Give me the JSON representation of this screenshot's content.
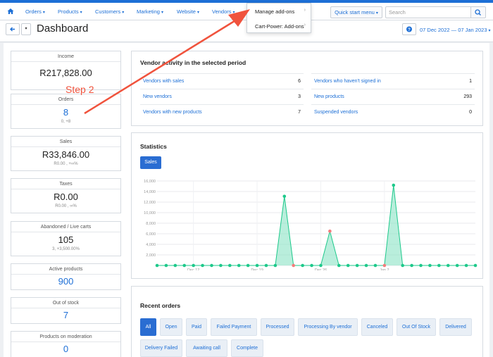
{
  "nav": {
    "items": [
      {
        "label": "Orders"
      },
      {
        "label": "Products"
      },
      {
        "label": "Customers"
      },
      {
        "label": "Marketing"
      },
      {
        "label": "Website"
      },
      {
        "label": "Vendors"
      }
    ],
    "quick_start": "Quick start menu",
    "search_placeholder": "Search"
  },
  "dropdown": {
    "items": [
      {
        "label": "Manage add-ons"
      },
      {
        "label": "Cart-Power: Add-ons"
      }
    ]
  },
  "header": {
    "title": "Dashboard",
    "date_range": "07 Dec 2022 — 07 Jan 2023"
  },
  "annotation": {
    "step": "Step 2",
    "color": "#f0533d"
  },
  "stats": [
    {
      "label": "Income",
      "value": "R217,828.00",
      "sub": ""
    },
    {
      "label": "Orders",
      "value": "8",
      "sub": "0, +8"
    },
    {
      "label": "Sales",
      "value": "R33,846.00",
      "sub": "R0.00 , +∞%"
    },
    {
      "label": "Taxes",
      "value": "R0.00",
      "sub": "R0.00 , ∞%"
    },
    {
      "label": "Abandoned / Live carts",
      "value": "105",
      "sub": "3, +3,500.00%"
    },
    {
      "label": "Active products",
      "value": "900",
      "sub": ""
    },
    {
      "label": "Out of stock",
      "value": "7",
      "sub": ""
    },
    {
      "label": "Products on moderation",
      "value": "0",
      "sub": ""
    }
  ],
  "vendor_activity": {
    "title": "Vendor activity in the selected period",
    "left": [
      {
        "label": "Vendors with sales",
        "value": "6"
      },
      {
        "label": "New vendors",
        "value": "3"
      },
      {
        "label": "Vendors with new products",
        "value": "7"
      }
    ],
    "right": [
      {
        "label": "Vendors who haven't signed in",
        "value": "1"
      },
      {
        "label": "New products",
        "value": "293"
      },
      {
        "label": "Suspended vendors",
        "value": "0"
      }
    ]
  },
  "statistics": {
    "title": "Statistics",
    "tab": "Sales"
  },
  "chart_data": {
    "type": "area",
    "title": "",
    "x_ticks": [
      "Dec 12",
      "Dec 19",
      "Dec 26",
      "Jan 2"
    ],
    "x_tick_index": [
      4,
      11,
      18,
      25
    ],
    "y_ticks": [
      "0",
      "2,000",
      "4,000",
      "6,000",
      "8,000",
      "10,000",
      "12,000",
      "14,000",
      "16,000"
    ],
    "ylim": [
      0,
      16000
    ],
    "series": [
      {
        "values": [
          0,
          0,
          0,
          0,
          0,
          0,
          0,
          0,
          0,
          0,
          0,
          0,
          0,
          0,
          13100,
          0,
          0,
          0,
          0,
          6500,
          0,
          0,
          0,
          0,
          0,
          0,
          15200,
          0,
          0,
          0,
          0,
          0,
          0,
          0,
          0,
          0
        ]
      }
    ],
    "zero_point_color": "#1ec98b",
    "highlight_points": [
      15,
      19,
      25
    ],
    "highlight_color": "#f47c7c",
    "fill_color": "#7fe0bf",
    "grid": true
  },
  "recent_orders": {
    "title": "Recent orders",
    "filters_row1": [
      {
        "label": "All"
      },
      {
        "label": "Open"
      },
      {
        "label": "Paid"
      },
      {
        "label": "Failed Payment"
      },
      {
        "label": "Processed"
      },
      {
        "label": "Processing By vendor"
      },
      {
        "label": "Canceled"
      },
      {
        "label": "Out Of Stock"
      },
      {
        "label": "Delivered"
      }
    ],
    "filters_row2": [
      {
        "label": "Delivery Failed"
      },
      {
        "label": "Awaiting call"
      },
      {
        "label": "Complete"
      }
    ]
  }
}
